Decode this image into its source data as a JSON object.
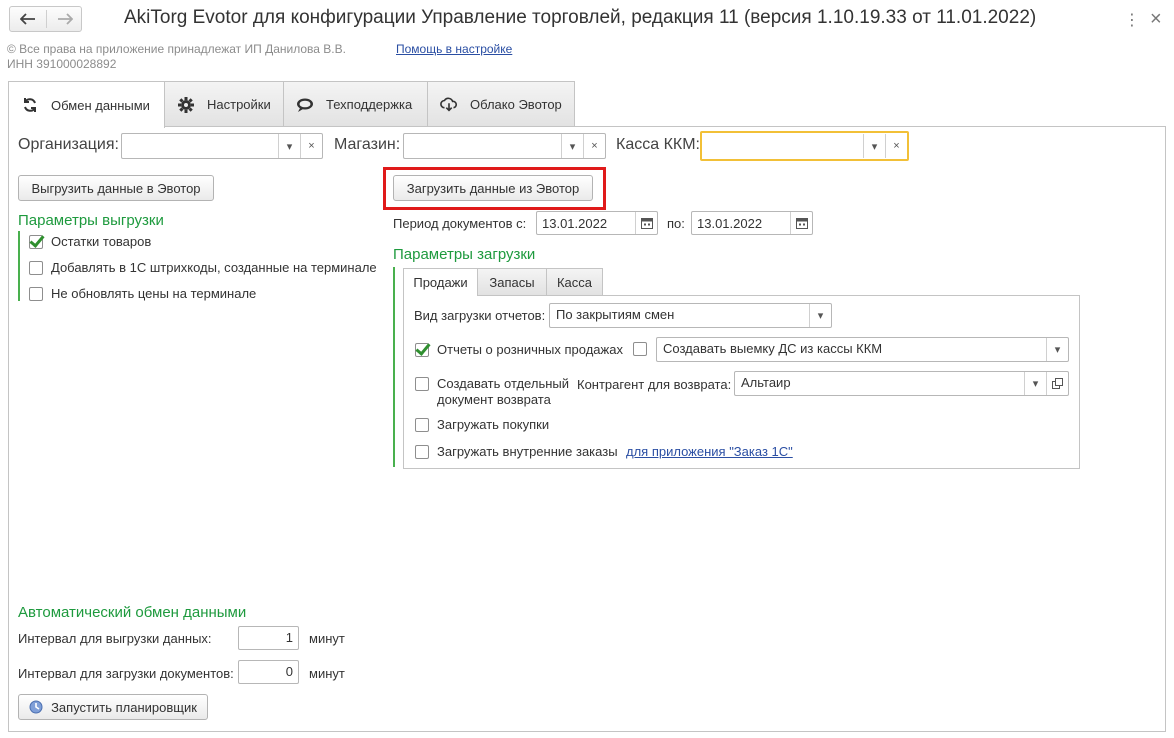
{
  "window": {
    "title": "AkiTorg Evotor для конфигурации Управление торговлей, редакция 11 (версия 1.10.19.33 от 11.01.2022)",
    "copyright_line1": "© Все права на приложение принадлежат ИП Данилова В.В.",
    "copyright_line2": "ИНН 391000028892",
    "help_link": "Помощь в настройке",
    "menu_glyph": "⋮",
    "close_glyph": "×"
  },
  "tabs": [
    {
      "label": "Обмен данными",
      "icon": "sync-icon",
      "active": true
    },
    {
      "label": "Настройки",
      "icon": "gear-icon",
      "active": false
    },
    {
      "label": "Техподдержка",
      "icon": "chat-icon",
      "active": false
    },
    {
      "label": "Облако Эвотор",
      "icon": "cloud-download-icon",
      "active": false
    }
  ],
  "filters": {
    "organization_label": "Организация:",
    "organization_value": "",
    "store_label": "Магазин:",
    "store_value": "",
    "kkm_label": "Касса ККМ:",
    "kkm_value": "",
    "clear_glyph": "×",
    "dropdown_glyph": "▾"
  },
  "export": {
    "button": "Выгрузить данные в Эвотор",
    "section_title": "Параметры выгрузки",
    "options": [
      {
        "label": "Остатки товаров",
        "checked": true
      },
      {
        "label": "Добавлять в 1С штрихкоды, созданные на терминале",
        "checked": false
      },
      {
        "label": "Не обновлять цены на терминале",
        "checked": false
      }
    ]
  },
  "import": {
    "button": "Загрузить данные из Эвотор",
    "period_label": "Период  документов с:",
    "date_from": "13.01.2022",
    "to_label": "по:",
    "date_to": "13.01.2022",
    "section_title": "Параметры загрузки",
    "subtabs": [
      {
        "label": "Продажи",
        "active": true
      },
      {
        "label": "Запасы",
        "active": false
      },
      {
        "label": "Касса",
        "active": false
      }
    ],
    "report_type_label": "Вид загрузки отчетов:",
    "report_type_value": "По закрытиям смен",
    "retail_reports_label": "Отчеты о розничных продажах",
    "retail_reports_checked": true,
    "withdrawal_checked": false,
    "withdrawal_value": "Создавать выемку ДС из кассы ККМ",
    "separate_return_label_1": "Создавать отдельный",
    "separate_return_label_2": "документ возврата",
    "separate_return_checked": false,
    "counterparty_label": "Контрагент для возврата:",
    "counterparty_value": "Альтаир",
    "load_purchases_label": "Загружать покупки",
    "load_purchases_checked": false,
    "load_orders_label": "Загружать внутренние заказы",
    "load_orders_checked": false,
    "orders_link": "для приложения \"Заказ 1С\""
  },
  "auto": {
    "section_title": "Автоматический обмен данными",
    "export_interval_label": "Интервал для выгрузки данных:",
    "export_interval_value": "1",
    "import_interval_label": "Интервал для загрузки документов:",
    "import_interval_value": "0",
    "unit": "минут",
    "scheduler_button": "Запустить планировщик"
  },
  "colors": {
    "accent_green": "#1e9a3e",
    "highlight_red": "#e01a1a",
    "focus_yellow": "#f2c037",
    "link_blue": "#2a4ea3"
  }
}
